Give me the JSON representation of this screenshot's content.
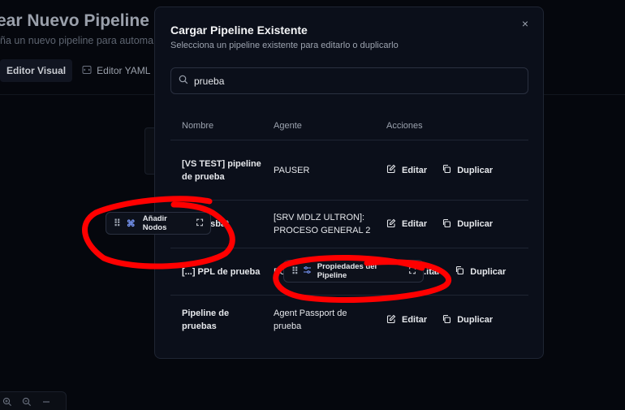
{
  "background": {
    "page_title": "ear Nuevo Pipeline",
    "page_subtitle": "ña un nuevo pipeline para automa",
    "tabs": [
      {
        "label": "Editor Visual",
        "active": true
      },
      {
        "label": "Editor YAML",
        "active": false
      }
    ],
    "zoom_controls": [
      "zoom-in-icon",
      "zoom-out-icon",
      "minus-icon"
    ]
  },
  "modal": {
    "title": "Cargar Pipeline Existente",
    "subtitle": "Selecciona un pipeline existente para editarlo o duplicarlo",
    "close_icon": "×",
    "search": {
      "value": "prueba",
      "icon": "search-icon"
    },
    "columns": [
      "Nombre",
      "Agente",
      "Acciones"
    ],
    "rows": [
      {
        "name": "[VS TEST] pipeline de prueba",
        "agent": "PAUSER",
        "edit": "Editar",
        "duplicate": "Duplicar"
      },
      {
        "name": "...sbat",
        "agent": "[SRV MDLZ ULTRON]: PROCESO GENERAL 2",
        "edit": "Editar",
        "duplicate": "Duplicar"
      },
      {
        "name": "[...] PPL de prueba",
        "agent": "PC",
        "edit": "...itar",
        "duplicate": "Duplicar"
      },
      {
        "name": "Pipeline de pruebas",
        "agent": "Agent Passport de prueba",
        "edit": "Editar",
        "duplicate": "Duplicar"
      }
    ]
  },
  "floating_nodes": [
    {
      "label": "Añadir Nodos",
      "icon": "command-icon"
    },
    {
      "label": "Propiedades del Pipeline",
      "icon": "sliders-icon"
    }
  ],
  "colors": {
    "annotation": "#ff0000",
    "modal_bg": "#0b0f1a",
    "accent_icon": "#7c9cff"
  }
}
